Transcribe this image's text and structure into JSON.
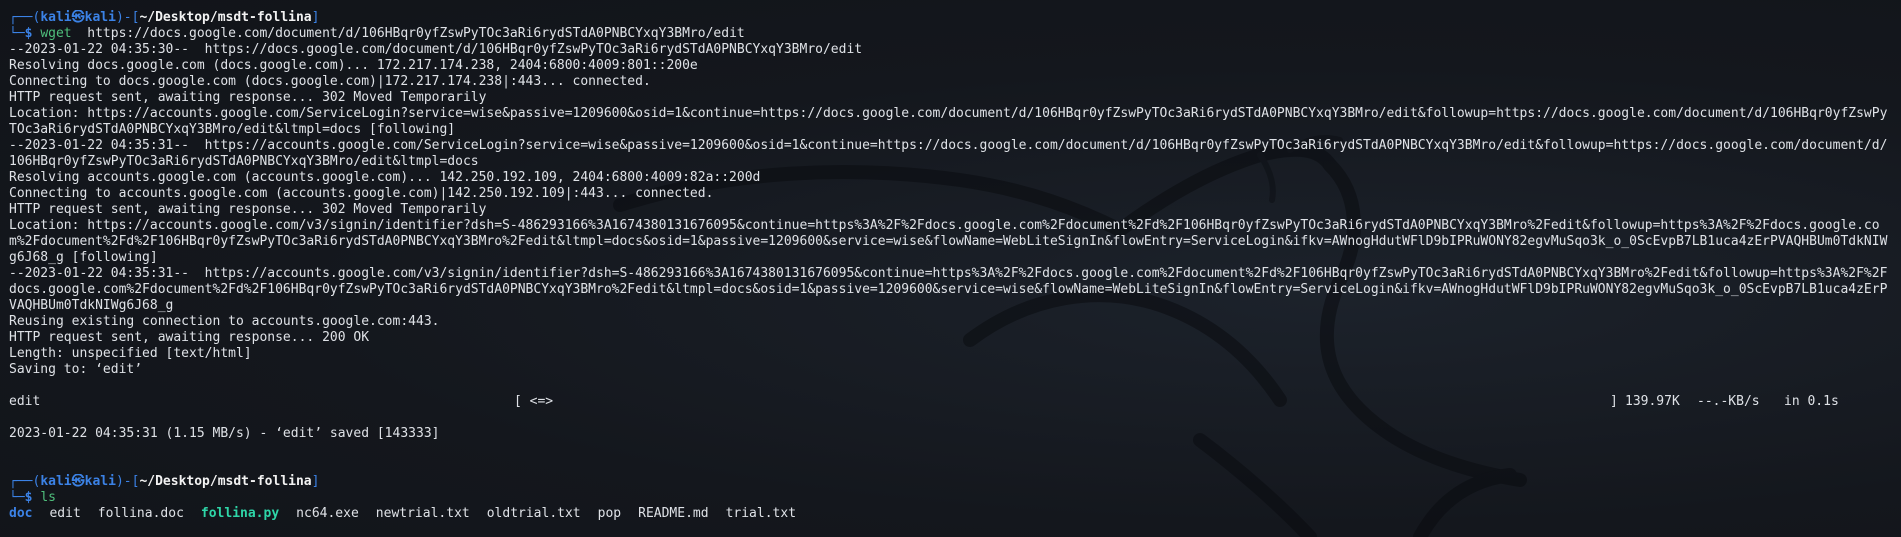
{
  "prompt1": {
    "frame_top": "┌──(",
    "user": "kali",
    "at": "㉿",
    "host": "kali",
    "mid": ")-[",
    "path": "~/Desktop/msdt-follina",
    "end": "]",
    "frame_bottom": "└─",
    "dollar": "$",
    "command": "wget",
    "argument": "https://docs.google.com/document/d/106HBqr0yfZswPyTOc3aRi6rydSTdA0PNBCYxqY3BMro/edit"
  },
  "output": [
    "--2023-01-22 04:35:30--  https://docs.google.com/document/d/106HBqr0yfZswPyTOc3aRi6rydSTdA0PNBCYxqY3BMro/edit",
    "Resolving docs.google.com (docs.google.com)... 172.217.174.238, 2404:6800:4009:801::200e",
    "Connecting to docs.google.com (docs.google.com)|172.217.174.238|:443... connected.",
    "HTTP request sent, awaiting response... 302 Moved Temporarily",
    "Location: https://accounts.google.com/ServiceLogin?service=wise&passive=1209600&osid=1&continue=https://docs.google.com/document/d/106HBqr0yfZswPyTOc3aRi6rydSTdA0PNBCYxqY3BMro/edit&followup=https://docs.google.com/document/d/106HBqr0yfZswPyTOc3aRi6rydSTdA0PNBCYxqY3BMro/edit&ltmpl=docs [following]",
    "--2023-01-22 04:35:31--  https://accounts.google.com/ServiceLogin?service=wise&passive=1209600&osid=1&continue=https://docs.google.com/document/d/106HBqr0yfZswPyTOc3aRi6rydSTdA0PNBCYxqY3BMro/edit&followup=https://docs.google.com/document/d/106HBqr0yfZswPyTOc3aRi6rydSTdA0PNBCYxqY3BMro/edit&ltmpl=docs",
    "Resolving accounts.google.com (accounts.google.com)... 142.250.192.109, 2404:6800:4009:82a::200d",
    "Connecting to accounts.google.com (accounts.google.com)|142.250.192.109|:443... connected.",
    "HTTP request sent, awaiting response... 302 Moved Temporarily",
    "Location: https://accounts.google.com/v3/signin/identifier?dsh=S-486293166%3A1674380131676095&continue=https%3A%2F%2Fdocs.google.com%2Fdocument%2Fd%2F106HBqr0yfZswPyTOc3aRi6rydSTdA0PNBCYxqY3BMro%2Fedit&followup=https%3A%2F%2Fdocs.google.com%2Fdocument%2Fd%2F106HBqr0yfZswPyTOc3aRi6rydSTdA0PNBCYxqY3BMro%2Fedit&ltmpl=docs&osid=1&passive=1209600&service=wise&flowName=WebLiteSignIn&flowEntry=ServiceLogin&ifkv=AWnogHdutWFlD9bIPRuWONY82egvMuSqo3k_o_0ScEvpB7LB1uca4zErPVAQHBUm0TdkNIWg6J68_g [following]",
    "--2023-01-22 04:35:31--  https://accounts.google.com/v3/signin/identifier?dsh=S-486293166%3A1674380131676095&continue=https%3A%2F%2Fdocs.google.com%2Fdocument%2Fd%2F106HBqr0yfZswPyTOc3aRi6rydSTdA0PNBCYxqY3BMro%2Fedit&followup=https%3A%2F%2Fdocs.google.com%2Fdocument%2Fd%2F106HBqr0yfZswPyTOc3aRi6rydSTdA0PNBCYxqY3BMro%2Fedit&ltmpl=docs&osid=1&passive=1209600&service=wise&flowName=WebLiteSignIn&flowEntry=ServiceLogin&ifkv=AWnogHdutWFlD9bIPRuWONY82egvMuSqo3k_o_0ScEvpB7LB1uca4zErPVAQHBUm0TdkNIWg6J68_g",
    "Reusing existing connection to accounts.google.com:443.",
    "HTTP request sent, awaiting response... 200 OK",
    "Length: unspecified [text/html]",
    "Saving to: ‘edit’"
  ],
  "progress": {
    "filename": "edit",
    "bar": "[ <=>",
    "bar_end": "]",
    "size": "139.97K",
    "rate": "--.-KB/s",
    "time": "in 0.1s"
  },
  "saved_line": "2023-01-22 04:35:31 (1.15 MB/s) - ‘edit’ saved [143333]",
  "prompt2": {
    "frame_top": "┌──(",
    "user": "kali",
    "at": "㉿",
    "host": "kali",
    "mid": ")-[",
    "path": "~/Desktop/msdt-follina",
    "end": "]",
    "frame_bottom": "└─",
    "dollar": "$",
    "command": "ls"
  },
  "ls_items": [
    {
      "name": "doc",
      "kind": "dir"
    },
    {
      "name": "edit",
      "kind": "file"
    },
    {
      "name": "follina.doc",
      "kind": "file"
    },
    {
      "name": "follina.py",
      "kind": "exec"
    },
    {
      "name": "nc64.exe",
      "kind": "file"
    },
    {
      "name": "newtrial.txt",
      "kind": "file"
    },
    {
      "name": "oldtrial.txt",
      "kind": "file"
    },
    {
      "name": "pop",
      "kind": "file"
    },
    {
      "name": "README.md",
      "kind": "file"
    },
    {
      "name": "trial.txt",
      "kind": "file"
    }
  ],
  "colors": {
    "background": "#14171d",
    "prompt_blue": "#3b82e6",
    "command_green": "#4fbf7c",
    "exec_teal": "#2ed6a8",
    "text": "#dfe2e7"
  },
  "icons": {
    "background_logo": "kali-dragon-watermark"
  }
}
